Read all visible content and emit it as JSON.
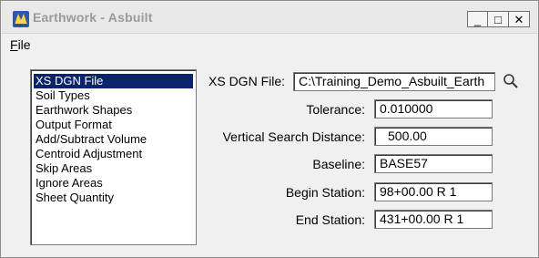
{
  "window": {
    "title": "Earthwork - Asbuilt",
    "controls": {
      "minimize": "_",
      "maximize": "□",
      "close": "✕"
    }
  },
  "menu": {
    "file_accesskey": "F",
    "file_rest": "ile"
  },
  "list": {
    "items": [
      "XS DGN File",
      "Soil Types",
      "Earthwork Shapes",
      "Output Format",
      "Add/Subtract Volume",
      "Centroid Adjustment",
      "Skip Areas",
      "Ignore Areas",
      "Sheet Quantity"
    ],
    "selected_index": 0
  },
  "fields": {
    "xs_dgn_file": {
      "label": "XS DGN File:",
      "value": "C:\\Training_Demo_Asbuilt_Earth"
    },
    "tolerance": {
      "label": "Tolerance:",
      "value": "0.010000"
    },
    "vertical_search_distance": {
      "label": "Vertical Search Distance:",
      "value": "500.00"
    },
    "baseline": {
      "label": "Baseline:",
      "value": "BASE57"
    },
    "begin_station": {
      "label": "Begin Station:",
      "value": "98+00.00 R 1"
    },
    "end_station": {
      "label": "End Station:",
      "value": "431+00.00 R 1"
    }
  },
  "icons": {
    "app": "earthwork-app-icon",
    "browse": "search-icon"
  },
  "colors": {
    "selection": "#0a246a",
    "title_text": "#9a9a9a"
  }
}
